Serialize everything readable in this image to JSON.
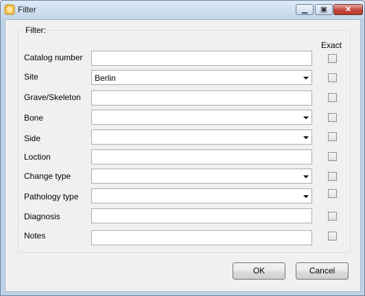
{
  "window": {
    "title": "Filter"
  },
  "filter_group": {
    "title": "Filter:",
    "exact_header": "Exact",
    "rows": [
      {
        "label": "Catalog number",
        "type": "text",
        "value": "",
        "exact": false
      },
      {
        "label": "Site",
        "type": "combo",
        "value": "Berlin",
        "exact": false
      },
      {
        "label": "Grave/Skeleton",
        "type": "text",
        "value": "",
        "exact": false
      },
      {
        "label": "Bone",
        "type": "combo",
        "value": "",
        "exact": false
      },
      {
        "label": "Side",
        "type": "combo",
        "value": "",
        "exact": false
      },
      {
        "label": "Loction",
        "type": "text",
        "value": "",
        "exact": false
      },
      {
        "label": "Change type",
        "type": "combo",
        "value": "",
        "exact": false
      },
      {
        "label": "Pathology type",
        "type": "combo",
        "value": "",
        "exact": false
      },
      {
        "label": "Diagnosis",
        "type": "text",
        "value": "",
        "exact": false
      },
      {
        "label": "Notes",
        "type": "text",
        "value": "",
        "exact": false
      }
    ]
  },
  "buttons": {
    "ok": "OK",
    "cancel": "Cancel"
  }
}
